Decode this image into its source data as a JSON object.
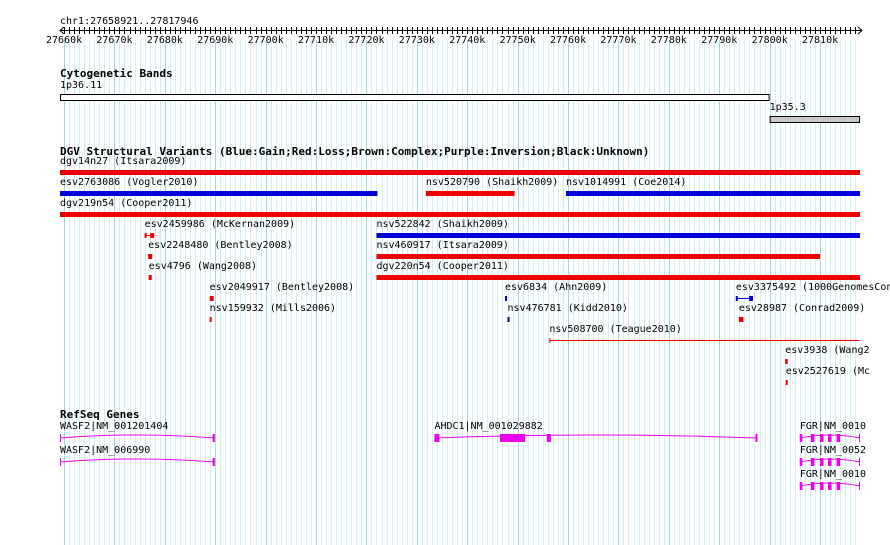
{
  "location": "chr1:27658921..27817946",
  "ruler": {
    "start": 27658921,
    "end": 27817946,
    "tick_labels": [
      "27660k",
      "27670k",
      "27680k",
      "27690k",
      "27700k",
      "27710k",
      "27720k",
      "27730k",
      "27740k",
      "27750k",
      "27760k",
      "27770k",
      "27780k",
      "27790k",
      "27800k",
      "27810k"
    ]
  },
  "colors": {
    "grid_major": "#9fd7e0",
    "grid_minor": "#cfeff2",
    "gain": "#0000dd",
    "loss": "#ee0000",
    "complex": "#8b4513",
    "gene": "#ee00ee",
    "band_light": "#ffffff",
    "band_gray": "#c8c8c8"
  },
  "tracks": {
    "cytobands": {
      "title": "Cytogenetic Bands",
      "bands": [
        {
          "name": "1p36.11",
          "start": 27658921,
          "end": 27800000,
          "fill": "white"
        },
        {
          "name": "1p35.3",
          "start": 27800000,
          "end": 27817946,
          "fill": "gray"
        }
      ]
    },
    "dgv": {
      "title": "DGV Structural Variants (Blue:Gain;Red:Loss;Brown:Complex;Purple:Inversion;Black:Unknown)",
      "features": [
        {
          "label": "dgv14n27 (Itsara2009)",
          "start": 27658921,
          "end": 27817946,
          "type": "loss",
          "row": 0
        },
        {
          "label": "esv2763086 (Vogler2010)",
          "start": 27658921,
          "end": 27722200,
          "type": "gain",
          "row": 1
        },
        {
          "label": "nsv520790 (Shaikh2009)",
          "start": 27731800,
          "end": 27749400,
          "type": "loss",
          "row": 1
        },
        {
          "label": "nsv1014991 (Coe2014)",
          "start": 27759600,
          "end": 27817946,
          "type": "gain",
          "row": 1
        },
        {
          "label": "dgv219n54 (Cooper2011)",
          "start": 27658921,
          "end": 27817946,
          "type": "loss",
          "row": 2
        },
        {
          "label": "esv2459986 (McKernan2009)",
          "start": 27676000,
          "end": 27677900,
          "type": "loss",
          "row": 3,
          "style": "dumbbell"
        },
        {
          "label": "nsv522842 (Shaikh2009)",
          "start": 27722000,
          "end": 27817946,
          "type": "gain",
          "row": 3
        },
        {
          "label": "esv2248480 (Bentley2008)",
          "start": 27676700,
          "end": 27677500,
          "type": "loss",
          "row": 4
        },
        {
          "label": "nsv460917 (Itsara2009)",
          "start": 27722000,
          "end": 27810000,
          "type": "loss",
          "row": 4
        },
        {
          "label": "esv4796 (Wang2008)",
          "start": 27676800,
          "end": 27677400,
          "type": "loss",
          "row": 5
        },
        {
          "label": "dgv220n54 (Cooper2011)",
          "start": 27722000,
          "end": 27817946,
          "type": "loss",
          "row": 5
        },
        {
          "label": "esv2049917 (Bentley2008)",
          "start": 27688900,
          "end": 27689700,
          "type": "loss",
          "row": 6
        },
        {
          "label": "esv6834 (Ahn2009)",
          "start": 27747500,
          "end": 27747800,
          "type": "gain",
          "row": 6
        },
        {
          "label": "esv3375492 (1000GenomesCon",
          "start": 27793300,
          "end": 27796700,
          "type": "gain",
          "row": 6,
          "style": "dumbbell"
        },
        {
          "label": "nsv159932 (Mills2006)",
          "start": 27688900,
          "end": 27689200,
          "type": "loss",
          "row": 7
        },
        {
          "label": "nsv476781 (Kidd2010)",
          "start": 27748000,
          "end": 27748400,
          "type": "gain",
          "row": 7
        },
        {
          "label": "esv28987 (Conrad2009)",
          "start": 27793900,
          "end": 27794800,
          "type": "loss",
          "row": 7
        },
        {
          "label": "nsv508700 (Teague2010)",
          "start": 27756300,
          "end": 27817946,
          "type": "loss",
          "row": 8,
          "style": "thin"
        },
        {
          "label": "esv3938 (Wang2",
          "start": 27803100,
          "end": 27803600,
          "type": "loss",
          "row": 9
        },
        {
          "label": "esv2527619 (Mc",
          "start": 27803200,
          "end": 27803500,
          "type": "loss",
          "row": 10
        }
      ]
    },
    "refseq": {
      "title": "RefSeq Genes",
      "genes": [
        {
          "label": "WASF2|NM_001201404",
          "start": 27658921,
          "end": 27689900,
          "row": 0,
          "strand": "-",
          "exons": [
            [
              27689500,
              27689900
            ]
          ]
        },
        {
          "label": "WASF2|NM_006990",
          "start": 27658921,
          "end": 27689900,
          "row": 1,
          "strand": "-",
          "exons": [
            [
              27689500,
              27689900
            ]
          ]
        },
        {
          "label": "AHDC1|NM_001029882",
          "start": 27733500,
          "end": 27797500,
          "row": 0,
          "strand": "-",
          "exons": [
            [
              27733500,
              27734500
            ],
            [
              27746500,
              27751500
            ],
            [
              27755800,
              27756600
            ],
            [
              27797200,
              27797500
            ]
          ]
        },
        {
          "label": "FGR|NM_0010",
          "start": 27806000,
          "end": 27817946,
          "row": 0,
          "strand": "-",
          "exons": [
            [
              27806000,
              27806500
            ],
            [
              27808200,
              27808900
            ],
            [
              27810000,
              27810700
            ],
            [
              27811600,
              27812300
            ],
            [
              27813300,
              27814000
            ]
          ]
        },
        {
          "label": "FGR|NM_0052",
          "start": 27806000,
          "end": 27817946,
          "row": 1,
          "strand": "-",
          "exons": [
            [
              27806000,
              27806500
            ],
            [
              27808200,
              27808900
            ],
            [
              27810000,
              27810700
            ],
            [
              27811600,
              27812300
            ],
            [
              27813300,
              27814000
            ]
          ]
        },
        {
          "label": "FGR|NM_0010",
          "start": 27806000,
          "end": 27817946,
          "row": 2,
          "strand": "-",
          "exons": [
            [
              27806000,
              27806500
            ],
            [
              27808200,
              27808900
            ],
            [
              27810000,
              27810700
            ],
            [
              27811600,
              27812300
            ],
            [
              27813300,
              27814000
            ]
          ]
        }
      ]
    }
  }
}
